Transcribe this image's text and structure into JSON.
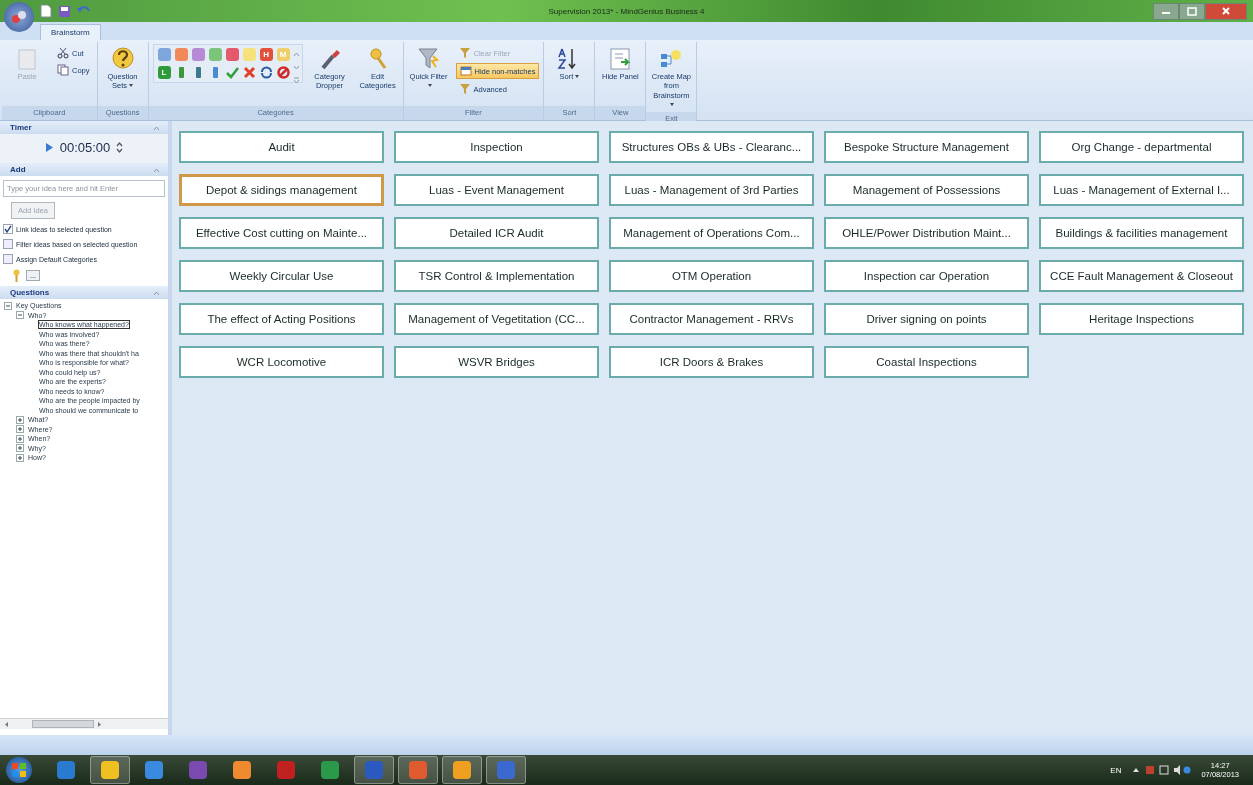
{
  "window": {
    "title": "Supervision 2013* - MindGenius Business 4"
  },
  "tabs": [
    {
      "label": "Brainstorm",
      "selected": true
    }
  ],
  "ribbon": [
    {
      "label": "Clipboard",
      "items": [
        {
          "kind": "large",
          "label": "Paste",
          "disabled": true
        },
        {
          "kind": "stack",
          "items": [
            {
              "label": "Cut",
              "disabled": false,
              "selected": false
            },
            {
              "label": "Copy",
              "disabled": false,
              "selected": false
            }
          ]
        }
      ]
    },
    {
      "label": "Questions",
      "items": [
        {
          "kind": "large",
          "label": "Question Sets",
          "dropdown": true,
          "disabled": false
        }
      ]
    },
    {
      "label": "Categories",
      "items": [
        {
          "kind": "swatches",
          "rows": [
            [
              {
                "color": "#7fa6dc"
              },
              {
                "color": "#f2895a"
              },
              {
                "color": "#b58ad6"
              },
              {
                "color": "#7cc47c"
              },
              {
                "color": "#e45a6a"
              },
              {
                "color": "#f6e27a"
              },
              {
                "color": "#e0503a",
                "letter": "H"
              },
              {
                "color": "#f0cf6a",
                "letter": "M"
              }
            ],
            [
              {
                "color": "#2f9a3a",
                "letter": "L"
              },
              {
                "color": "#3a9a3a"
              },
              {
                "color": "#3a7a8a"
              },
              {
                "color": "#4a8ad0"
              },
              {
                "color": "#2fa03a"
              },
              {
                "color": "#e0402a"
              },
              {
                "color": "#2a5aa0"
              },
              {
                "color": "#d02a2a"
              }
            ]
          ]
        },
        {
          "kind": "large",
          "label": "Category Dropper",
          "disabled": false
        },
        {
          "kind": "large",
          "label": "Edit Categories",
          "disabled": false
        }
      ]
    },
    {
      "label": "Filter",
      "items": [
        {
          "kind": "large",
          "label": "Quick Filter",
          "dropdown": true,
          "disabled": false
        },
        {
          "kind": "stack",
          "items": [
            {
              "label": "Clear Filter",
              "disabled": true,
              "selected": false
            },
            {
              "label": "Hide non-matches",
              "disabled": false,
              "selected": true
            },
            {
              "label": "Advanced",
              "disabled": false,
              "selected": false
            }
          ]
        }
      ]
    },
    {
      "label": "Sort",
      "items": [
        {
          "kind": "large",
          "label": "Sort",
          "dropdown": true,
          "disabled": false
        }
      ]
    },
    {
      "label": "View",
      "items": [
        {
          "kind": "large",
          "label": "Hide Panel",
          "disabled": false
        }
      ]
    },
    {
      "label": "Exit",
      "items": [
        {
          "kind": "large",
          "label": "Create Map from Brainstorm",
          "dropdown": true,
          "disabled": false
        }
      ]
    }
  ],
  "timer": {
    "title": "Timer",
    "time": "00:05:00"
  },
  "add": {
    "title": "Add",
    "placeholder": "Type your idea here and hit Enter",
    "button": {
      "label": "Add Idea",
      "disabled": true
    },
    "options": [
      {
        "label": "Link ideas to selected question",
        "checked": true
      },
      {
        "label": "Filter ideas based on selected question",
        "checked": false
      },
      {
        "label": "Assign Default Categories",
        "checked": false
      }
    ],
    "browse": "..."
  },
  "questions": {
    "title": "Questions",
    "tree": [
      {
        "label": "Key Questions",
        "expanded": true,
        "children": [
          {
            "label": "Who?",
            "expanded": true,
            "children": [
              {
                "label": "Who knows what happened?",
                "selected": true
              },
              {
                "label": "Who was involved?",
                "selected": false
              },
              {
                "label": "Who was there?",
                "selected": false
              },
              {
                "label": "Who was there that shouldn't ha",
                "selected": false
              },
              {
                "label": "Who is responsible for what?",
                "selected": false
              },
              {
                "label": "Who could help us?",
                "selected": false
              },
              {
                "label": "Who are the experts?",
                "selected": false
              },
              {
                "label": "Who needs to know?",
                "selected": false
              },
              {
                "label": "Who are the people impacted by",
                "selected": false
              },
              {
                "label": "Who should we communicate to",
                "selected": false
              }
            ]
          },
          {
            "label": "What?",
            "expanded": false
          },
          {
            "label": "Where?",
            "expanded": false
          },
          {
            "label": "When?",
            "expanded": false
          },
          {
            "label": "Why?",
            "expanded": false
          },
          {
            "label": "How?",
            "expanded": false
          }
        ]
      }
    ]
  },
  "ideas": [
    {
      "label": "Audit",
      "selected": false
    },
    {
      "label": "Inspection",
      "selected": false
    },
    {
      "label": "Structures OBs & UBs - Clearanc...",
      "selected": false
    },
    {
      "label": "Bespoke Structure Management",
      "selected": false
    },
    {
      "label": "Org Change - departmental",
      "selected": false
    },
    {
      "label": "Depot & sidings management",
      "selected": true
    },
    {
      "label": "Luas - Event Management",
      "selected": false
    },
    {
      "label": "Luas - Management of 3rd Parties",
      "selected": false
    },
    {
      "label": "Management of Possessions",
      "selected": false
    },
    {
      "label": "Luas - Management of External I...",
      "selected": false
    },
    {
      "label": "Effective Cost cutting on Mainte...",
      "selected": false
    },
    {
      "label": "Detailed ICR Audit",
      "selected": false
    },
    {
      "label": "Management of Operations Com...",
      "selected": false
    },
    {
      "label": "OHLE/Power Distribution Maint...",
      "selected": false
    },
    {
      "label": "Buildings & facilities management",
      "selected": false
    },
    {
      "label": "Weekly Circular Use",
      "selected": false
    },
    {
      "label": "TSR Control & Implementation",
      "selected": false
    },
    {
      "label": "OTM Operation",
      "selected": false
    },
    {
      "label": "Inspection car Operation",
      "selected": false
    },
    {
      "label": "CCE Fault Management & Closeout",
      "selected": false
    },
    {
      "label": "The effect of Acting Positions",
      "selected": false
    },
    {
      "label": "Management of Vegetitation (CC...",
      "selected": false
    },
    {
      "label": "Contractor Management - RRVs",
      "selected": false
    },
    {
      "label": "Driver signing on points",
      "selected": false
    },
    {
      "label": "Heritage Inspections",
      "selected": false
    },
    {
      "label": "WCR Locomotive",
      "selected": false
    },
    {
      "label": "WSVR Bridges",
      "selected": false
    },
    {
      "label": "ICR Doors & Brakes",
      "selected": false
    },
    {
      "label": "Coastal Inspections",
      "selected": false
    }
  ],
  "taskbar": {
    "apps": [
      {
        "color": "#2a7ad0",
        "running": false
      },
      {
        "color": "#f0c020",
        "running": true
      },
      {
        "color": "#3a8ae0",
        "running": false
      },
      {
        "color": "#7a4ab0",
        "running": false
      },
      {
        "color": "#f08a30",
        "running": false
      },
      {
        "color": "#c02020",
        "running": false
      },
      {
        "color": "#2a9a4a",
        "running": false
      },
      {
        "color": "#2a5ac0",
        "running": true
      },
      {
        "color": "#e05a30",
        "running": true
      },
      {
        "color": "#f0a020",
        "running": true
      },
      {
        "color": "#3a6ad0",
        "running": true
      }
    ],
    "language": "EN",
    "time": "14:27",
    "date": "07/08/2013"
  }
}
